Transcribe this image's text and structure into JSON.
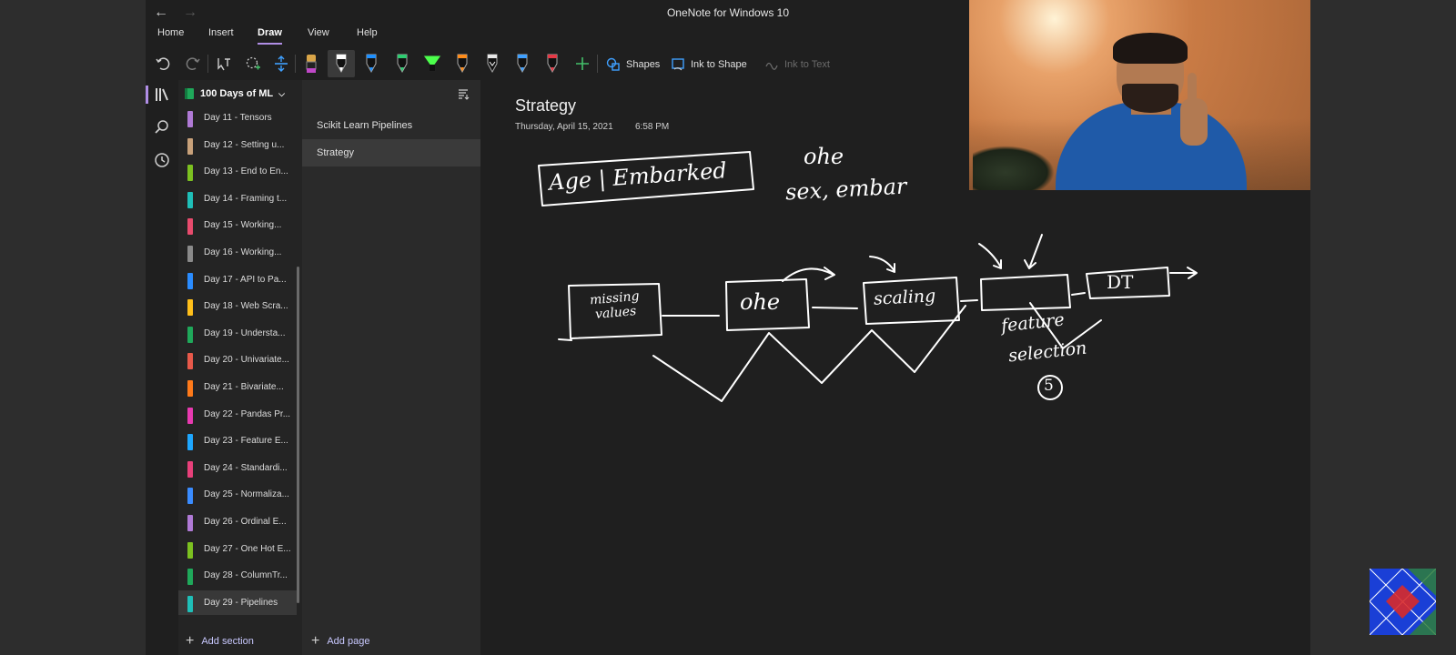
{
  "window": {
    "title": "OneNote for Windows 10"
  },
  "ribbon": {
    "tabs": [
      {
        "label": "Home"
      },
      {
        "label": "Insert"
      },
      {
        "label": "Draw",
        "active": true
      },
      {
        "label": "View"
      },
      {
        "label": "Help"
      }
    ]
  },
  "toolbar": {
    "shapes_label": "Shapes",
    "ink_to_shape_label": "Ink to Shape",
    "ink_to_text_label": "Ink to Text",
    "pen_colors": [
      "#c048c8",
      "#ffffff",
      "#1e90ff",
      "#2ecc71",
      "#4cff4c",
      "#ff8c1a",
      "#e8e8e8",
      "#3fa0ff",
      "#e63946"
    ]
  },
  "notebook": {
    "name": "100 Days of ML"
  },
  "sections": [
    {
      "label": "Day 11 - Tensors",
      "color": "#b07ad6"
    },
    {
      "label": "Day 12 - Setting u...",
      "color": "#c8a17a"
    },
    {
      "label": "Day 13 - End to En...",
      "color": "#7cc120"
    },
    {
      "label": "Day 14 - Framing t...",
      "color": "#1fbfb8"
    },
    {
      "label": "Day 15 - Working...",
      "color": "#e84b6d"
    },
    {
      "label": "Day 16 - Working...",
      "color": "#8a8a8a"
    },
    {
      "label": "Day 17 - API to Pa...",
      "color": "#2a8cff"
    },
    {
      "label": "Day 18 - Web Scra...",
      "color": "#ffbf1a"
    },
    {
      "label": "Day 19 - Understa...",
      "color": "#1fa85a"
    },
    {
      "label": "Day 20 - Univariate...",
      "color": "#e8594a"
    },
    {
      "label": "Day 21 - Bivariate...",
      "color": "#ff7a1a"
    },
    {
      "label": "Day 22 - Pandas Pr...",
      "color": "#e83ab0"
    },
    {
      "label": "Day 23 - Feature E...",
      "color": "#1ea7ff"
    },
    {
      "label": "Day 24 - Standardi...",
      "color": "#e8407a"
    },
    {
      "label": "Day 25 - Normaliza...",
      "color": "#3a8cff"
    },
    {
      "label": "Day 26 - Ordinal E...",
      "color": "#b07ad6"
    },
    {
      "label": "Day 27 - One Hot E...",
      "color": "#7cc120"
    },
    {
      "label": "Day 28 - ColumnTr...",
      "color": "#1fa85a"
    },
    {
      "label": "Day 29 - Pipelines",
      "color": "#1fbfb8",
      "selected": true
    }
  ],
  "add_section_label": "Add section",
  "pages": [
    {
      "label": "Scikit Learn Pipelines"
    },
    {
      "label": "Strategy",
      "selected": true
    }
  ],
  "add_page_label": "Add page",
  "page": {
    "title": "Strategy",
    "date": "Thursday, April 15, 2021",
    "time": "6:58 PM"
  },
  "ink": {
    "box1": "Age | Embarked",
    "note1": "ohe",
    "note2": "sex, embar",
    "step1": "missing values",
    "step2": "ohe",
    "step3": "scaling",
    "step4_caption1": "feature",
    "step4_caption2": "selection",
    "step4_badge": "5",
    "step5": "DT"
  }
}
